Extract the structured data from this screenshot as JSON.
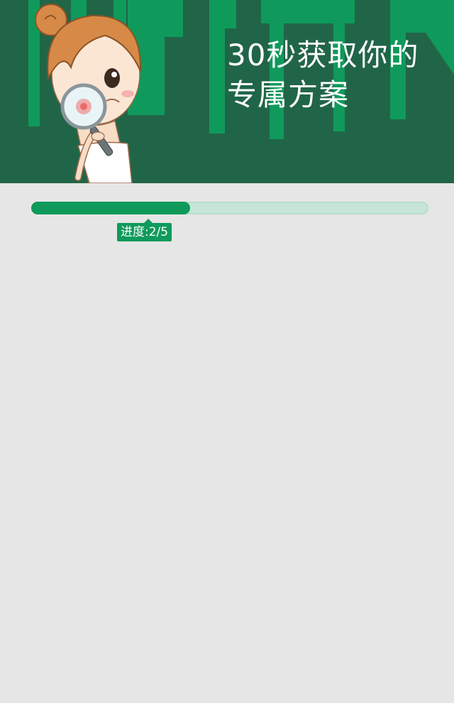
{
  "header": {
    "title_line1": "30秒获取你的",
    "title_line2": "专属方案",
    "illustration": "girl-with-magnifying-glass"
  },
  "progress": {
    "label": "进度:2/5",
    "current": 2,
    "total": 5,
    "fraction": 0.4
  },
  "colors": {
    "banner_dark": "#216548",
    "banner_light": "#0f9a5b",
    "progress_fill": "#0f9a5b",
    "progress_track": "#c6e6d7",
    "page_background": "#e6e6e6"
  }
}
